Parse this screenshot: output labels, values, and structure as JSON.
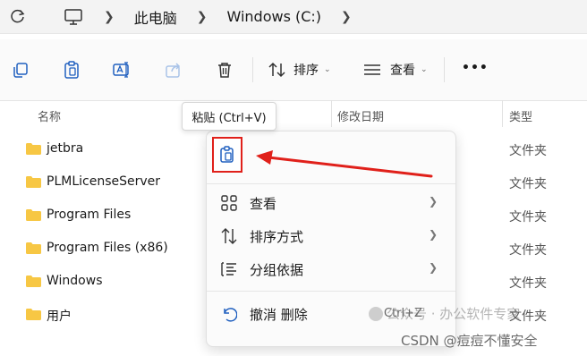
{
  "breadcrumb": {
    "items": [
      "此电脑",
      "Windows (C:)"
    ]
  },
  "toolbar": {
    "sort_label": "排序",
    "view_label": "查看",
    "more_label": "•••"
  },
  "columns": {
    "name": "名称",
    "modified": "修改日期",
    "type": "类型"
  },
  "files": [
    {
      "name": "jetbra",
      "type": "文件夹"
    },
    {
      "name": "PLMLicenseServer",
      "type": "文件夹"
    },
    {
      "name": "Program Files",
      "type": "文件夹"
    },
    {
      "name": "Program Files (x86)",
      "type": "文件夹"
    },
    {
      "name": "Windows",
      "type": "文件夹"
    },
    {
      "name": "用户",
      "type": "文件夹"
    }
  ],
  "tooltip": "粘贴 (Ctrl+V)",
  "context_menu": {
    "items": [
      {
        "label": "查看",
        "icon": "grid-icon"
      },
      {
        "label": "排序方式",
        "icon": "sort-icon"
      },
      {
        "label": "分组依据",
        "icon": "group-icon"
      }
    ],
    "undo": {
      "label": "撤消 删除",
      "shortcut": "Ctrl+Z"
    }
  },
  "watermarks": {
    "top": "公众号 · 办公软件专家",
    "bottom": "CSDN @痘痘不懂安全"
  },
  "colors": {
    "highlight_red": "#e0201a",
    "accent_blue": "#1f5fbf",
    "folder_yellow": "#f7c744"
  }
}
